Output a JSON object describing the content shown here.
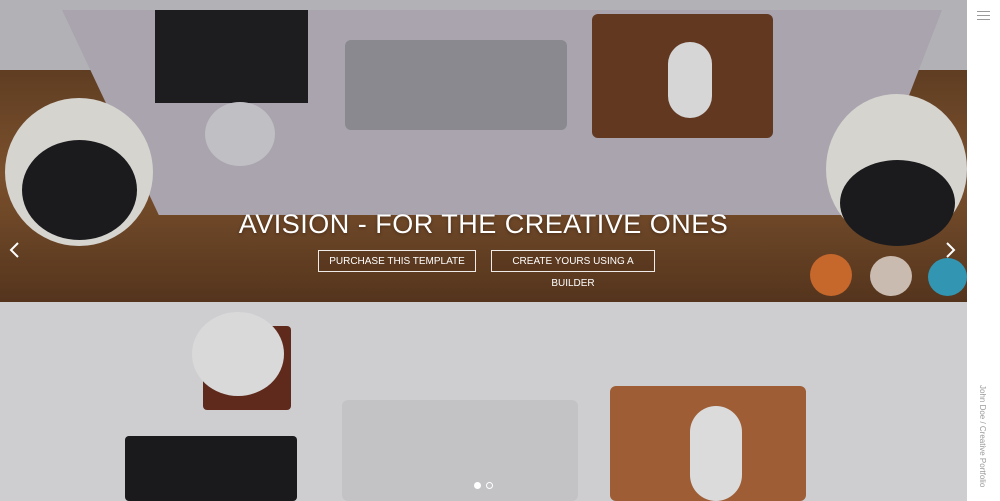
{
  "hero": {
    "title": "AVISION - FOR THE CREATIVE ONES",
    "buttons": {
      "purchase_label": "PURCHASE THIS TEMPLATE",
      "builder_label": "CREATE YOURS USING A BUILDER"
    },
    "arrows": {
      "prev_glyph": "‹",
      "next_glyph": "›"
    },
    "slides": {
      "count": 2,
      "active_index": 0
    }
  },
  "sidebar": {
    "menu_icon": "hamburger-menu-icon",
    "vertical_text": "John Doe / Creative Portfolio"
  },
  "colors": {
    "text_on_hero": "#ffffff",
    "sidebar_bg": "#ffffff",
    "sidebar_text": "#9a9a9a"
  }
}
